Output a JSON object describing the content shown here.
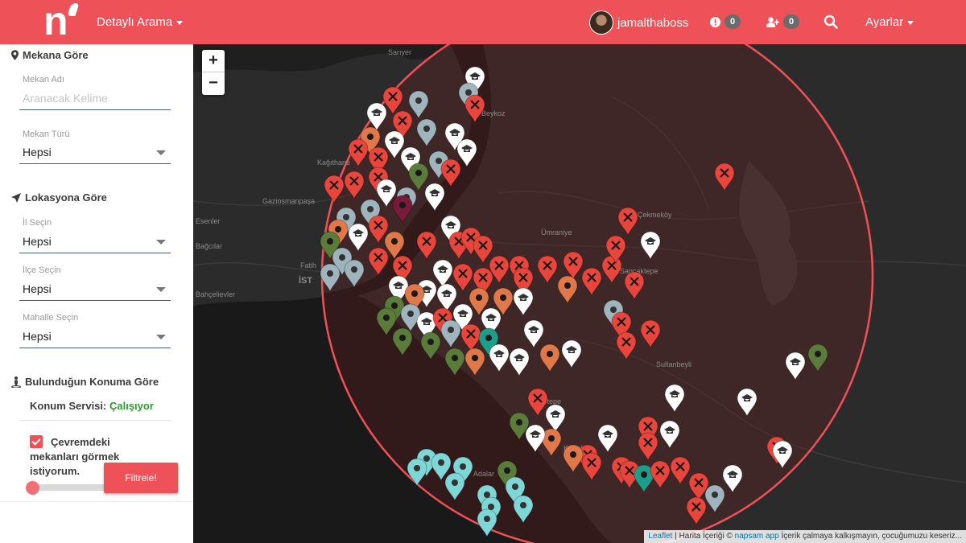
{
  "header": {
    "detail_search": "Detaylı Arama",
    "username": "jamalthaboss",
    "alerts_count": "0",
    "friend_requests_count": "0",
    "settings": "Ayarlar"
  },
  "sidebar": {
    "venue_section": "Mekana Göre",
    "venue_name_label": "Mekan Adı",
    "venue_name_placeholder": "Aranacak Kelime",
    "venue_type_label": "Mekan Türü",
    "venue_type_value": "Hepsi",
    "location_section": "Lokasyona Göre",
    "city_label": "İl Seçin",
    "city_value": "Hepsi",
    "district_label": "İlçe Seçin",
    "district_value": "Hepsi",
    "neighborhood_label": "Mahalle Seçin",
    "neighborhood_value": "Hepsi",
    "current_location_section": "Bulunduğun Konuma Göre",
    "location_service_label": "Konum Servisi:",
    "location_service_status": "Çalışıyor",
    "nearby_checkbox_label": "Çevremdeki mekanları görmek istiyorum.",
    "nearby_checked": true,
    "filter_button": "Filtrele!"
  },
  "map": {
    "zoom_in": "+",
    "zoom_out": "−",
    "labels": [
      "Sarıyer",
      "Beykoz",
      "Kağıthane",
      "Gaziosmanpaşa",
      "Esenler",
      "Bağcılar",
      "Fatih",
      "İST",
      "Bahçelievler",
      "Çekmeköy",
      "Ümraniye",
      "Sancaktepe",
      "Sultanbeyli",
      "Maltepe",
      "Kartal",
      "Adalar"
    ],
    "attribution_link": "Leaflet",
    "attribution_text_1": " | Harita İçeriği © ",
    "attribution_link_2": "napsam app",
    "attribution_text_2": " İçerik çalmaya kalkışmayın, çocuğumuzu keseriz..."
  },
  "colors": {
    "brand": "#ef5158",
    "marker_red": "#e8453c",
    "marker_white": "#ffffff",
    "marker_green": "#5b7b3a",
    "marker_cyan": "#7fd6d6",
    "marker_orange": "#e0784a",
    "marker_grey": "#9fb4bc",
    "marker_teal": "#1e9e8a"
  }
}
